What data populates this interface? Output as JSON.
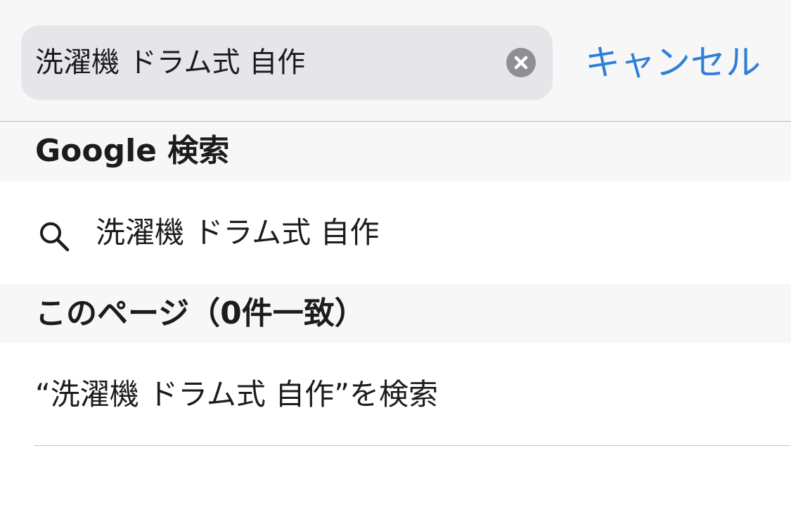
{
  "search": {
    "value": "洗濯機 ドラム式 自作",
    "cancel_label": "キャンセル",
    "clear_icon": "clear-circle-icon"
  },
  "sections": {
    "google": {
      "header": "Google 検索",
      "suggestion": "洗濯機 ドラム式 自作",
      "icon": "search-icon"
    },
    "page": {
      "header": "このページ（0件一致）",
      "find_label": "“洗濯機 ドラム式 自作”を検索"
    }
  },
  "colors": {
    "accent": "#2f7fd9",
    "field_bg": "#e6e6ea",
    "header_bg": "#f7f7f7",
    "clear_icon": "#8e8e93"
  }
}
